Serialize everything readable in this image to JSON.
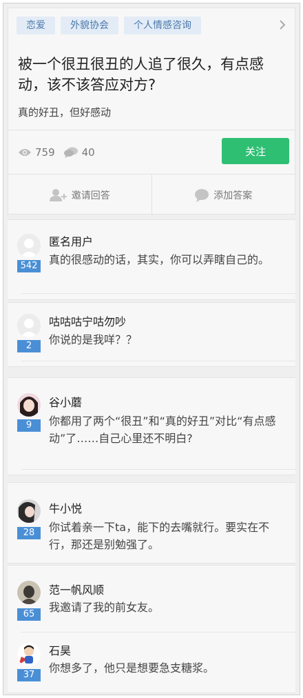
{
  "question": {
    "tags": [
      "恋爱",
      "外貌协会",
      "个人情感咨询"
    ],
    "title": "被一个很丑很丑的人追了很久，有点感动，该不该答应对方?",
    "description": "真的好丑，但好感动",
    "views": "759",
    "comments": "40",
    "follow_label": "关注",
    "invite_label": "邀请回答",
    "add_answer_label": "添加答案"
  },
  "answers": [
    {
      "author": "匿名用户",
      "votes": "542",
      "text": "真的很感动的话，其实，你可以弄瞎自己的。"
    },
    {
      "author": "咕咕咕宁咕勿吵",
      "votes": "2",
      "text": "你说的是我咩？？"
    },
    {
      "author": "谷小蘑",
      "votes": "9",
      "text": "你都用了两个“很丑”和“真的好丑”对比“有点感动”了……自己心里还不明白?"
    },
    {
      "author": "牛小悦",
      "votes": "28",
      "text": "你试着亲一下ta，能下的去嘴就行。要实在不行，那还是别勉强了。"
    },
    {
      "author": "范一帆风顺",
      "votes": "65",
      "text": "我邀请了我的前女友。"
    },
    {
      "author": "石昊",
      "votes": "37",
      "text": "你想多了，他只是想要急支糖浆。"
    }
  ],
  "colors": {
    "accent_green": "#2ebf73",
    "tag_blue": "#4b79ad",
    "vote_blue": "#4a8fd6"
  }
}
